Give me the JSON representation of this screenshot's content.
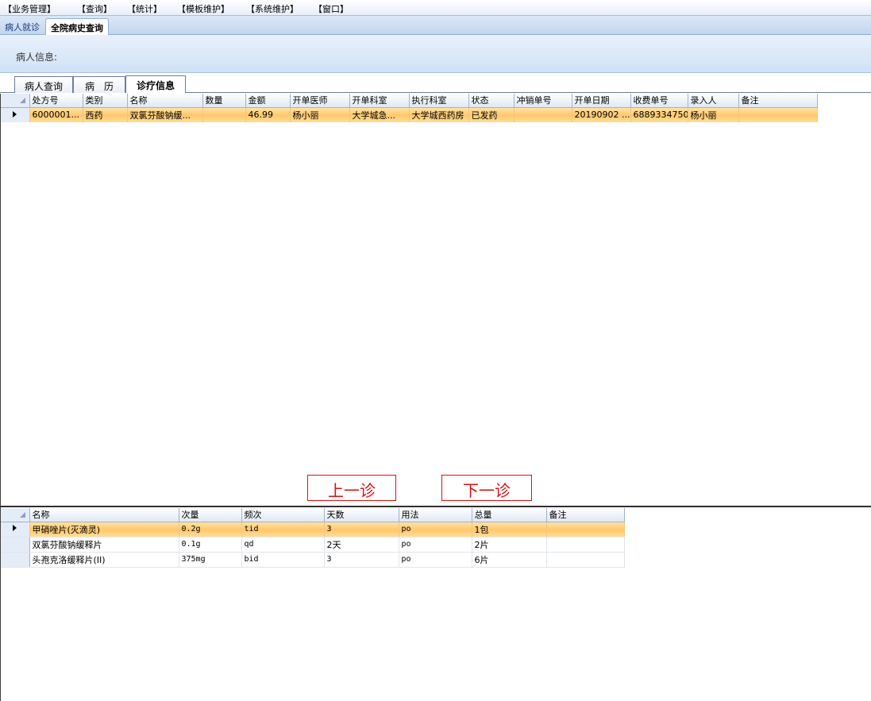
{
  "menu": [
    "【业务管理】",
    "【查询】",
    "【统计】",
    "【模板维护】",
    "【系统维护】",
    "【窗口】"
  ],
  "doc_tabs": [
    {
      "label": "病人就诊",
      "active": false
    },
    {
      "label": "全院病史查询",
      "active": true
    }
  ],
  "patient_info": {
    "label": "病人信息:"
  },
  "sub_tabs": [
    {
      "label": "病人查询",
      "active": false
    },
    {
      "label": "病　历",
      "active": false
    },
    {
      "label": "诊疗信息",
      "active": true
    }
  ],
  "prescription_table": {
    "columns": [
      "处方号",
      "类别",
      "名称",
      "数量",
      "金额",
      "开单医师",
      "开单科室",
      "执行科室",
      "状态",
      "冲销单号",
      "开单日期",
      "收费单号",
      "录入人",
      "备注"
    ],
    "rows": [
      [
        "6000001...",
        "西药",
        "双氯芬酸钠缓...",
        "",
        "46.99",
        "杨小丽",
        "大学城急...",
        "大学城西药房",
        "已发药",
        "",
        "20190902 ...",
        "6889334750",
        "杨小丽",
        ""
      ]
    ]
  },
  "nav": {
    "prev_label": "上一诊",
    "next_label": "下一诊"
  },
  "detail_table": {
    "columns": [
      "名称",
      "次量",
      "频次",
      "天数",
      "用法",
      "总量",
      "备注"
    ],
    "rows": [
      [
        "甲硝唑片(灭滴灵)",
        "0.2g",
        "tid",
        "3",
        "po",
        "1包",
        ""
      ],
      [
        "双氯芬酸钠缓释片",
        "0.1g",
        "qd",
        "2天",
        "po",
        "2片",
        ""
      ],
      [
        "头孢克洛缓释片(II)",
        "375mg",
        "bid",
        "3",
        "po",
        "6片",
        ""
      ]
    ]
  }
}
